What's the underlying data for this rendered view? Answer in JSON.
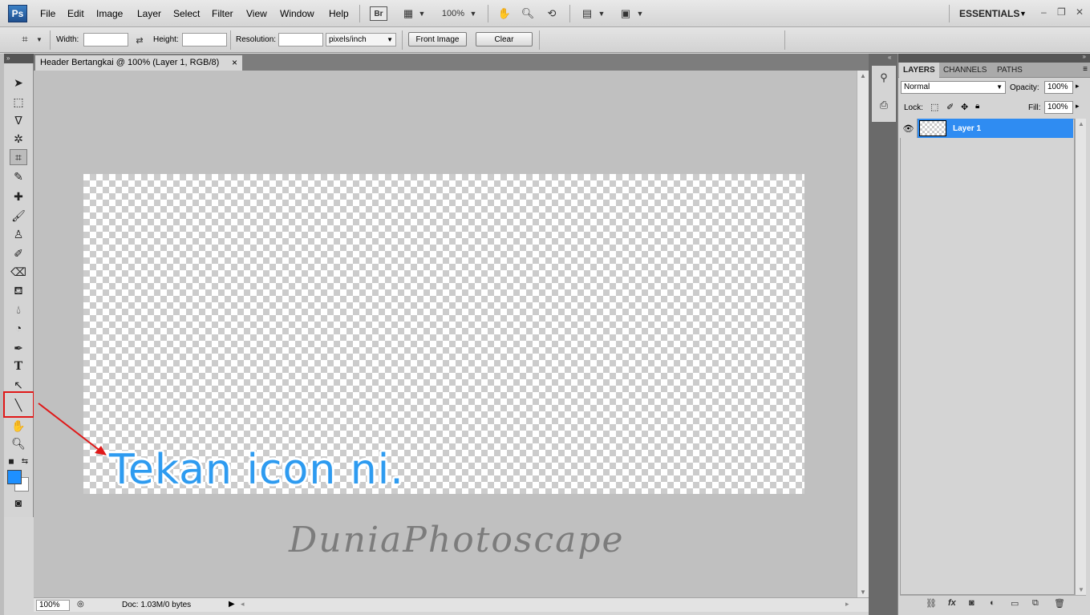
{
  "menubar": {
    "logo": "Ps",
    "items": [
      "File",
      "Edit",
      "Image",
      "Layer",
      "Select",
      "Filter",
      "View",
      "Window",
      "Help"
    ],
    "bridge_label": "Br",
    "zoom": "100%",
    "workspace": "ESSENTIALS",
    "workspace_arrow": "▼",
    "window_controls": [
      "–",
      "❐",
      "✕"
    ]
  },
  "options": {
    "width_label": "Width:",
    "width_value": "",
    "height_label": "Height:",
    "height_value": "",
    "resolution_label": "Resolution:",
    "resolution_value": "",
    "resolution_unit": "pixels/inch",
    "front_image_label": "Front Image",
    "clear_label": "Clear"
  },
  "document": {
    "tab_title": "Header Bertangkai @ 100% (Layer 1, RGB/8)",
    "tab_close": "×",
    "status_zoom": "100%",
    "status_info": "Doc: 1.03M/0 bytes"
  },
  "annotation": {
    "text": "Tekan icon ni.",
    "color": "#2e9bf0",
    "highlight_color": "#e01818"
  },
  "watermark": {
    "text": "DuniaPhotoscape"
  },
  "tools": {
    "foreground_color": "#1e90ff",
    "background_color": "#ffffff"
  },
  "layers_panel": {
    "tabs": [
      "LAYERS",
      "CHANNELS",
      "PATHS"
    ],
    "blend_mode": "Normal",
    "opacity_label": "Opacity:",
    "opacity_value": "100%",
    "lock_label": "Lock:",
    "fill_label": "Fill:",
    "fill_value": "100%",
    "layers": [
      {
        "name": "Layer 1",
        "selected": true
      }
    ],
    "selected_color": "#2f8cf2"
  }
}
